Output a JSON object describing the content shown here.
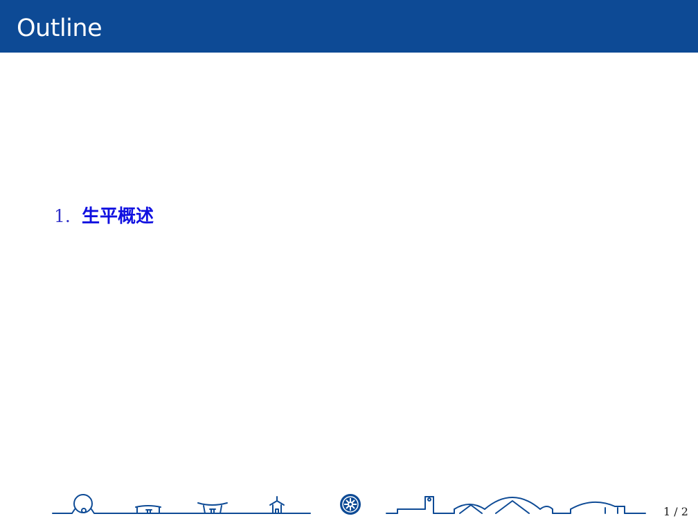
{
  "slide": {
    "title": "Outline"
  },
  "outline": {
    "items": [
      {
        "number": "1.",
        "label": "生平概述"
      }
    ]
  },
  "footer": {
    "page_number": "1 / 2",
    "art_icon": "campus-skyline-icon",
    "emblem_icon": "university-emblem-icon",
    "color": "#0d4a95"
  }
}
